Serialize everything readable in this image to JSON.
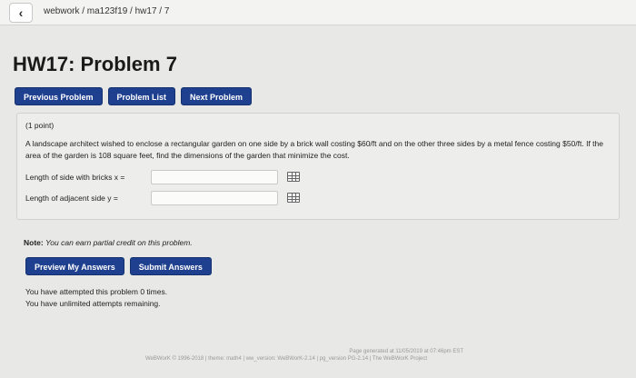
{
  "breadcrumb": {
    "path": "webwork / ma123f19 / hw17 / 7"
  },
  "page": {
    "title": "HW17: Problem 7"
  },
  "nav": {
    "previous": "Previous Problem",
    "list": "Problem List",
    "next": "Next Problem"
  },
  "problem": {
    "points": "(1 point)",
    "statement": "A landscape architect wished to enclose a rectangular garden on one side by a brick wall costing $60/ft and on the other three sides by a metal fence costing $50/ft. If the area of the garden is 108 square feet, find the dimensions of the garden that minimize the cost.",
    "fields": [
      {
        "label": "Length of side with bricks x =",
        "value": ""
      },
      {
        "label": "Length of adjacent side y =",
        "value": ""
      }
    ]
  },
  "note": {
    "prefix": "Note:",
    "text": "You can earn partial credit on this problem."
  },
  "actions": {
    "preview": "Preview My Answers",
    "submit": "Submit Answers"
  },
  "attempts": {
    "line1": "You have attempted this problem 0 times.",
    "line2": "You have unlimited attempts remaining."
  },
  "footer": {
    "generated": "Page generated at 11/05/2019 at 07:46pm EST",
    "credits": "WeBWorK © 1996-2018 | theme: math4 | ww_version: WeBWorK-2.14 | pg_version PG-2.14 | The WeBWorK Project"
  }
}
